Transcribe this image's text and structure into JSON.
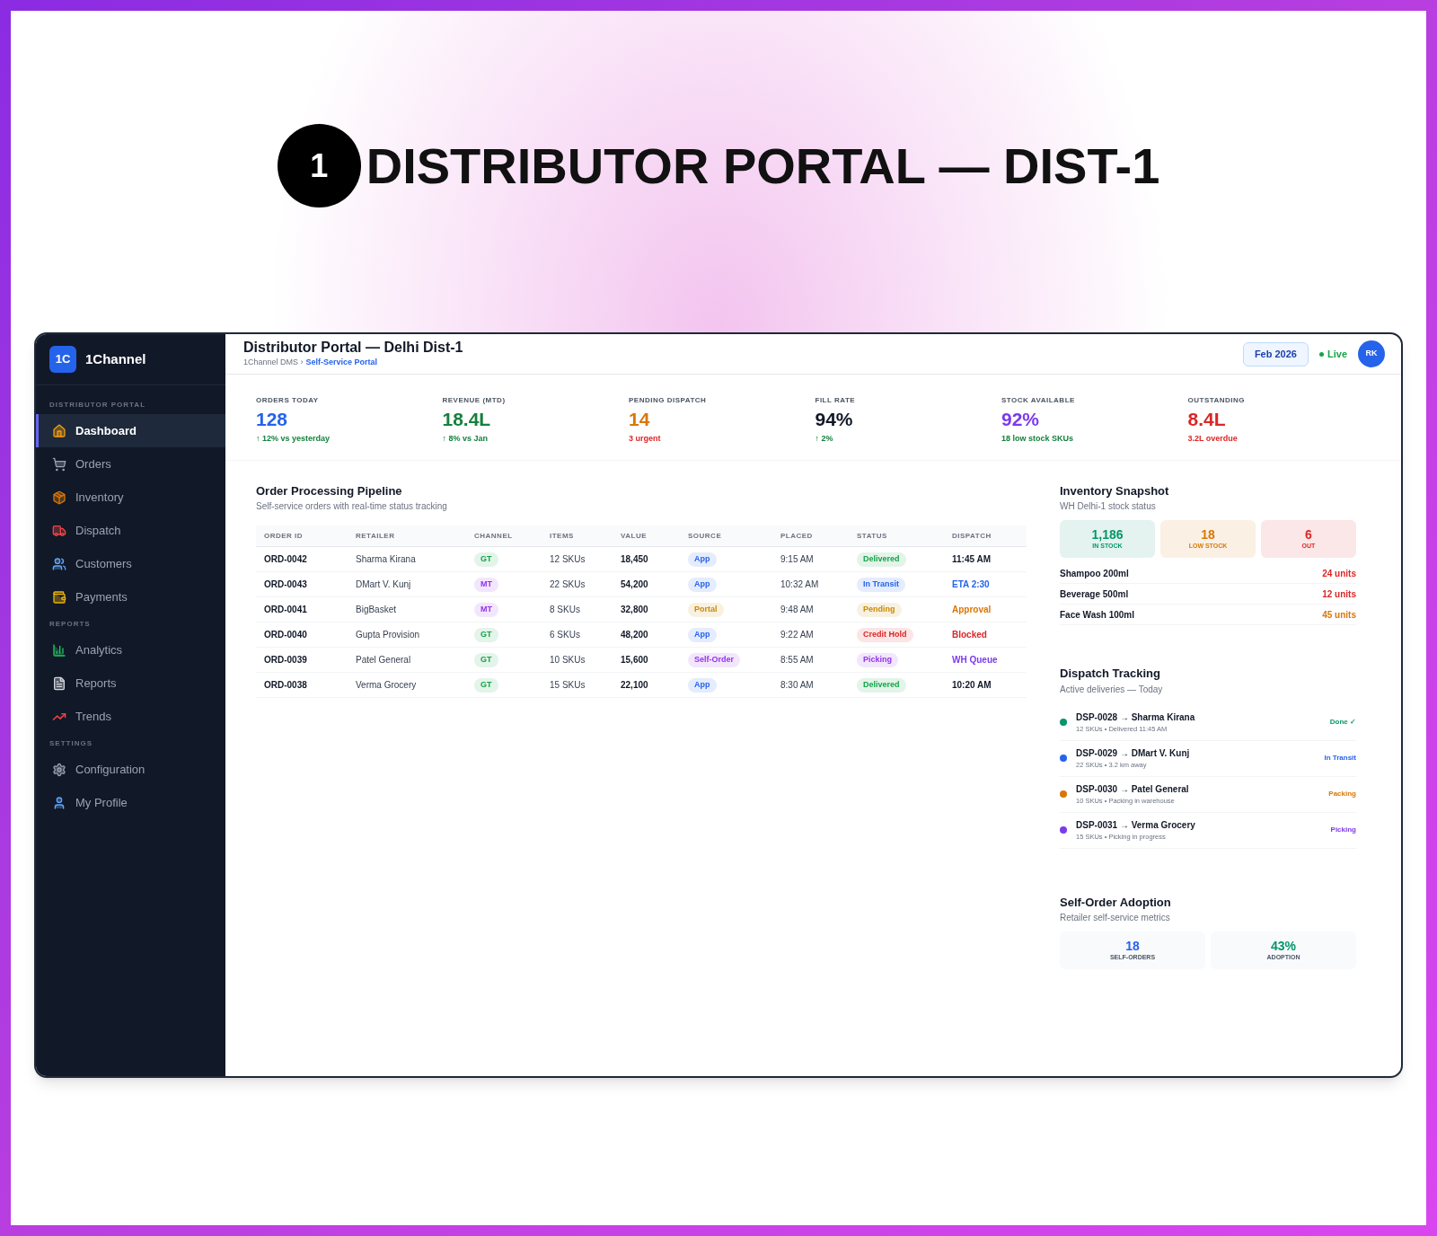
{
  "hero": {
    "number": "1",
    "title": "DISTRIBUTOR PORTAL — DIST-1"
  },
  "sidebar": {
    "logo_mark": "1C",
    "brand": "1Channel",
    "sections": [
      {
        "label": "DISTRIBUTOR PORTAL",
        "items": [
          {
            "label": "Dashboard",
            "selected": true
          },
          {
            "label": "Orders",
            "selected": false
          },
          {
            "label": "Inventory",
            "selected": false
          },
          {
            "label": "Dispatch",
            "selected": false
          },
          {
            "label": "Customers",
            "selected": false
          },
          {
            "label": "Payments",
            "selected": false
          }
        ]
      },
      {
        "label": "REPORTS",
        "items": [
          {
            "label": "Analytics",
            "selected": false
          },
          {
            "label": "Reports",
            "selected": false
          },
          {
            "label": "Trends",
            "selected": false
          }
        ]
      },
      {
        "label": "SETTINGS",
        "items": [
          {
            "label": "Configuration",
            "selected": false
          },
          {
            "label": "My Profile",
            "selected": false
          }
        ]
      }
    ]
  },
  "header": {
    "title": "Distributor Portal — Delhi Dist-1",
    "breadcrumb": "1Channel DMS ›",
    "breadcrumb_current": "Self-Service Portal",
    "date_button": "Feb 2026",
    "live": "Live",
    "avatar": "RK"
  },
  "kpis": [
    {
      "label": "ORDERS TODAY",
      "value": "128",
      "color": "#2563eb",
      "note": {
        "text": "↑ 12% vs yesterday",
        "color": "#15803d"
      }
    },
    {
      "label": "REVENUE (MTD)",
      "value": "18.4L",
      "color": "#15803d",
      "note": {
        "text": "↑ 8% vs Jan",
        "color": "#15803d"
      }
    },
    {
      "label": "PENDING DISPATCH",
      "value": "14",
      "color": "#d97706",
      "note": {
        "text": "3 urgent",
        "color": "#dc2626"
      }
    },
    {
      "label": "FILL RATE",
      "value": "94%",
      "color": "#111827",
      "note": {
        "text": "↑ 2%",
        "color": "#15803d"
      }
    },
    {
      "label": "STOCK AVAILABLE",
      "value": "92%",
      "color": "#7c3aed",
      "note": {
        "text": "18 low stock SKUs",
        "color": "#15803d"
      }
    },
    {
      "label": "OUTSTANDING",
      "value": "8.4L",
      "color": "#dc2626",
      "note": {
        "text": "3.2L overdue",
        "color": "#dc2626"
      }
    }
  ],
  "pipeline": {
    "title": "Order Processing Pipeline",
    "subtitle": "Self-service orders with real-time status tracking",
    "columns": [
      "ORDER ID",
      "RETAILER",
      "CHANNEL",
      "ITEMS",
      "VALUE",
      "SOURCE",
      "PLACED",
      "STATUS",
      "DISPATCH"
    ],
    "rows": [
      {
        "id": "ORD-0042",
        "retailer": "Sharma Kirana",
        "channel": {
          "text": "GT",
          "color": "#16a34a"
        },
        "items": "12 SKUs",
        "value": "18,450",
        "source": {
          "text": "App",
          "color": "#2563eb"
        },
        "placed": "9:15 AM",
        "status": {
          "text": "Delivered",
          "color": "#16a34a"
        },
        "dispatch": {
          "text": "11:45 AM",
          "color": "#111827"
        }
      },
      {
        "id": "ORD-0043",
        "retailer": "DMart V. Kunj",
        "channel": {
          "text": "MT",
          "color": "#9333ea"
        },
        "items": "22 SKUs",
        "value": "54,200",
        "source": {
          "text": "App",
          "color": "#2563eb"
        },
        "placed": "10:32 AM",
        "status": {
          "text": "In Transit",
          "color": "#2563eb"
        },
        "dispatch": {
          "text": "ETA 2:30",
          "color": "#2563eb"
        }
      },
      {
        "id": "ORD-0041",
        "retailer": "BigBasket",
        "channel": {
          "text": "MT",
          "color": "#9333ea"
        },
        "items": "8 SKUs",
        "value": "32,800",
        "source": {
          "text": "Portal",
          "color": "#ca8a04"
        },
        "placed": "9:48 AM",
        "status": {
          "text": "Pending",
          "color": "#ca8a04"
        },
        "dispatch": {
          "text": "Approval",
          "color": "#d97706"
        }
      },
      {
        "id": "ORD-0040",
        "retailer": "Gupta Provision",
        "channel": {
          "text": "GT",
          "color": "#16a34a"
        },
        "items": "6 SKUs",
        "value": "48,200",
        "source": {
          "text": "App",
          "color": "#2563eb"
        },
        "placed": "9:22 AM",
        "status": {
          "text": "Credit Hold",
          "color": "#dc2626"
        },
        "dispatch": {
          "text": "Blocked",
          "color": "#dc2626"
        }
      },
      {
        "id": "ORD-0039",
        "retailer": "Patel General",
        "channel": {
          "text": "GT",
          "color": "#16a34a"
        },
        "items": "10 SKUs",
        "value": "15,600",
        "source": {
          "text": "Self-Order",
          "color": "#9333ea"
        },
        "placed": "8:55 AM",
        "status": {
          "text": "Picking",
          "color": "#9333ea"
        },
        "dispatch": {
          "text": "WH Queue",
          "color": "#7c3aed"
        }
      },
      {
        "id": "ORD-0038",
        "retailer": "Verma Grocery",
        "channel": {
          "text": "GT",
          "color": "#16a34a"
        },
        "items": "15 SKUs",
        "value": "22,100",
        "source": {
          "text": "App",
          "color": "#2563eb"
        },
        "placed": "8:30 AM",
        "status": {
          "text": "Delivered",
          "color": "#16a34a"
        },
        "dispatch": {
          "text": "10:20 AM",
          "color": "#111827"
        }
      }
    ]
  },
  "inventory": {
    "title": "Inventory Snapshot",
    "subtitle": "WH Delhi-1 stock status",
    "tiles": [
      {
        "value": "1,186",
        "label": "IN STOCK",
        "color": "#059669"
      },
      {
        "value": "18",
        "label": "LOW STOCK",
        "color": "#d97706"
      },
      {
        "value": "6",
        "label": "OUT",
        "color": "#dc2626"
      }
    ],
    "items": [
      {
        "name": "Shampoo 200ml",
        "qty": "24 units",
        "color": "#dc2626"
      },
      {
        "name": "Beverage 500ml",
        "qty": "12 units",
        "color": "#dc2626"
      },
      {
        "name": "Face Wash 100ml",
        "qty": "45 units",
        "color": "#d97706"
      }
    ]
  },
  "dispatch": {
    "title": "Dispatch Tracking",
    "subtitle": "Active deliveries — Today",
    "items": [
      {
        "title": "DSP-0028 → Sharma Kirana",
        "detail": "12 SKUs • Delivered 11:45 AM",
        "status": "Done ✓",
        "color": "#059669"
      },
      {
        "title": "DSP-0029 → DMart V. Kunj",
        "detail": "22 SKUs • 3.2 km away",
        "status": "In Transit",
        "color": "#2563eb"
      },
      {
        "title": "DSP-0030 → Patel General",
        "detail": "10 SKUs • Packing in warehouse",
        "status": "Packing",
        "color": "#d97706"
      },
      {
        "title": "DSP-0031 → Verma Grocery",
        "detail": "15 SKUs • Picking in progress",
        "status": "Picking",
        "color": "#7c3aed"
      }
    ]
  },
  "adoption": {
    "title": "Self-Order Adoption",
    "subtitle": "Retailer self-service metrics",
    "stats": [
      {
        "value": "18",
        "label": "SELF-ORDERS",
        "color": "#2563eb"
      },
      {
        "value": "43%",
        "label": "ADOPTION",
        "color": "#059669"
      }
    ]
  }
}
